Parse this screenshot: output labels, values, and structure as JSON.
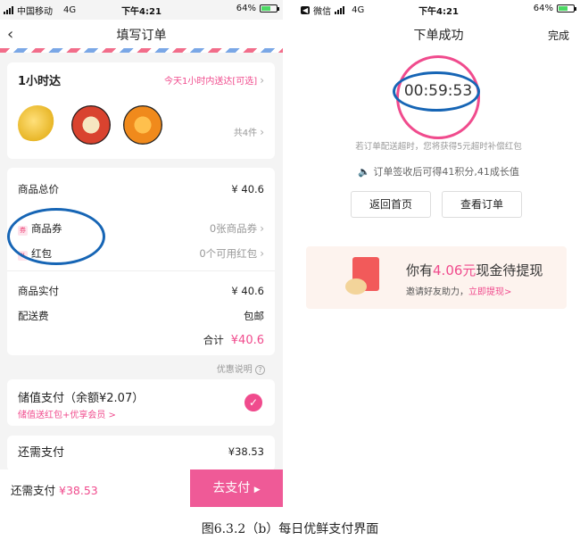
{
  "left": {
    "status": {
      "carrier": "中国移动",
      "network": "4G",
      "time": "下午4:21",
      "battery": "64%"
    },
    "title": "填写订单",
    "delivery": {
      "label": "1小时达",
      "option": "今天1小时内送达[可选]",
      "count": "共4件"
    },
    "fruits": [
      "banana-image",
      "apple-image",
      "orange-image"
    ],
    "summary": {
      "total_label": "商品总价",
      "total_value": "¥ 40.6",
      "coupon_label": "商品券",
      "coupon_value": "0张商品券",
      "redpack_label": "红包",
      "redpack_value": "0个可用红包",
      "actual_label": "商品实付",
      "actual_value": "¥ 40.6",
      "shipping_label": "配送费",
      "shipping_value": "包邮",
      "sum_label": "合计",
      "sum_value": "¥40.6"
    },
    "discount_note": "优惠说明",
    "stored": {
      "title": "储值支付（余额¥2.07）",
      "sub": "储值送红包+优享会员 >"
    },
    "need": {
      "label": "还需支付",
      "value": "¥38.53"
    },
    "bottom": {
      "label": "还需支付",
      "value": "¥38.53",
      "pay": "去支付"
    }
  },
  "right": {
    "status": {
      "carrier": "微信",
      "network": "4G",
      "time": "下午4:21",
      "battery": "64%"
    },
    "title": "下单成功",
    "done": "完成",
    "timer": "00:59:53",
    "late_note": "若订单配送超时，您将获得5元超时补偿红包",
    "points_note": "订单签收后可得41积分,41成长值",
    "home_button": "返回首页",
    "order_button": "查看订单",
    "cash": {
      "prefix": "你有",
      "amount": "4.06元",
      "suffix": "现金待提现",
      "invite": "邀请好友助力，",
      "link": "立即提现>"
    }
  },
  "caption": "图6.3.2（b）每日优鲜支付界面",
  "colors": {
    "accent": "#f04b8d",
    "annotation": "#1665b5"
  }
}
